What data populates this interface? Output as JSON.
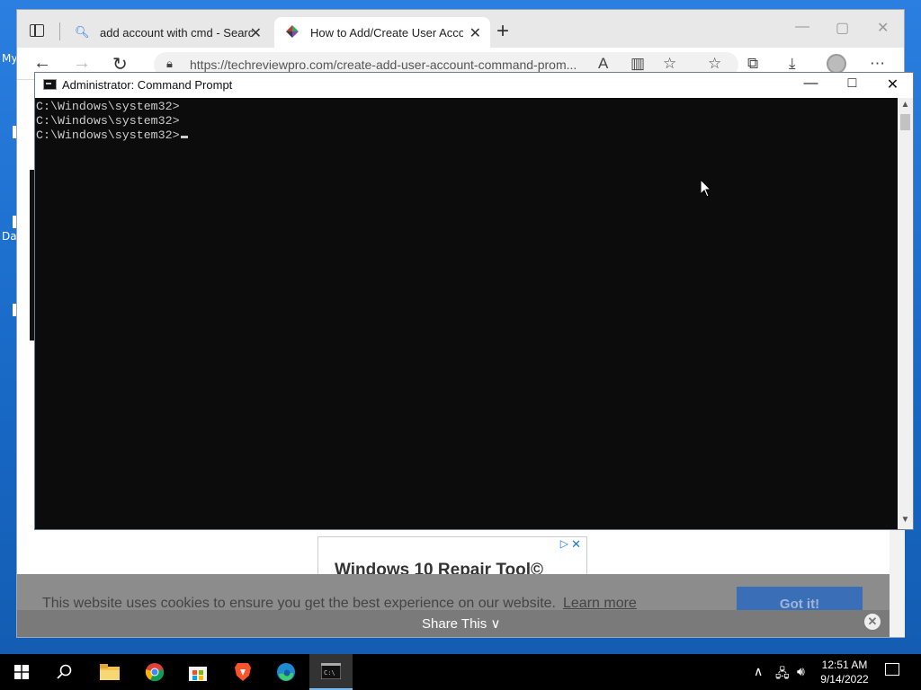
{
  "desktop": {
    "labels": [
      "My",
      "Da"
    ]
  },
  "browser": {
    "tabs": [
      {
        "title": "add account with cmd - Search",
        "icon": "search-icon",
        "active": false
      },
      {
        "title": "How to Add/Create User Accoun",
        "icon": "techreviewpro-favicon",
        "active": true
      }
    ],
    "url": "https://techreviewpro.com/create-add-user-account-command-prom...",
    "ad": {
      "title": "Windows 10 Repair Tool©"
    },
    "cookie": {
      "text": "This website uses cookies to ensure you get the best experience on our website.",
      "link": "Learn more",
      "button": "Got it!"
    },
    "share": {
      "label": "Share This"
    }
  },
  "cmd": {
    "title": "Administrator: Command Prompt",
    "lines": [
      "C:\\Windows\\system32>",
      "C:\\Windows\\system32>",
      "C:\\Windows\\system32>"
    ]
  },
  "taskbar": {
    "time": "12:51 AM",
    "date": "9/14/2022"
  }
}
